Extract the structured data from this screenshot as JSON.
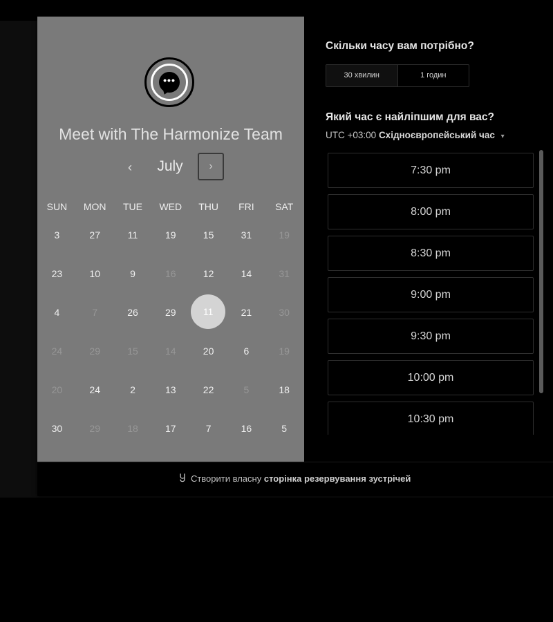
{
  "left": {
    "title": "Meet with The Harmonize Team",
    "logo_glyph": "•••",
    "month": "July",
    "prev_icon": "‹",
    "next_icon": "›"
  },
  "calendar": {
    "weekdays": [
      "SUN",
      "MON",
      "TUE",
      "WED",
      "THU",
      "FRI",
      "SAT"
    ],
    "weeks": [
      [
        {
          "d": "3",
          "off": false
        },
        {
          "d": "27",
          "off": false
        },
        {
          "d": "11",
          "off": false
        },
        {
          "d": "19",
          "off": false
        },
        {
          "d": "15",
          "off": false
        },
        {
          "d": "31",
          "off": false
        },
        {
          "d": "19",
          "off": true
        }
      ],
      [
        {
          "d": "23",
          "off": false
        },
        {
          "d": "10",
          "off": false
        },
        {
          "d": "9",
          "off": false
        },
        {
          "d": "16",
          "off": true
        },
        {
          "d": "12",
          "off": false
        },
        {
          "d": "14",
          "off": false
        },
        {
          "d": "31",
          "off": true
        }
      ],
      [
        {
          "d": "4",
          "off": false
        },
        {
          "d": "7",
          "off": true
        },
        {
          "d": "26",
          "off": false
        },
        {
          "d": "29",
          "off": false
        },
        {
          "d": "11",
          "off": false,
          "selected": true
        },
        {
          "d": "21",
          "off": false
        },
        {
          "d": "30",
          "off": true
        }
      ],
      [
        {
          "d": "24",
          "off": true
        },
        {
          "d": "29",
          "off": true
        },
        {
          "d": "15",
          "off": true
        },
        {
          "d": "14",
          "off": true
        },
        {
          "d": "20",
          "off": false
        },
        {
          "d": "6",
          "off": false
        },
        {
          "d": "19",
          "off": true
        }
      ],
      [
        {
          "d": "20",
          "off": true
        },
        {
          "d": "24",
          "off": false
        },
        {
          "d": "2",
          "off": false
        },
        {
          "d": "13",
          "off": false
        },
        {
          "d": "22",
          "off": false
        },
        {
          "d": "5",
          "off": true
        },
        {
          "d": "18",
          "off": false
        }
      ],
      [
        {
          "d": "30",
          "off": false
        },
        {
          "d": "29",
          "off": true
        },
        {
          "d": "18",
          "off": true
        },
        {
          "d": "17",
          "off": false
        },
        {
          "d": "7",
          "off": false
        },
        {
          "d": "16",
          "off": false
        },
        {
          "d": "5",
          "off": false
        }
      ]
    ]
  },
  "right": {
    "duration_heading": "Скільки часу вам потрібно?",
    "durations": [
      "30 хвилин",
      "1 годин"
    ],
    "time_heading": "Який час є найліпшим для вас?",
    "timezone_offset": "UTC +03:00",
    "timezone_name": "Східноєвропейський час",
    "timezone_caret": "▾",
    "slots": [
      "7:30 pm",
      "8:00 pm",
      "8:30 pm",
      "9:00 pm",
      "9:30 pm",
      "10:00 pm",
      "10:30 pm"
    ]
  },
  "footer": {
    "icon": "hubspot-sprocket-icon",
    "icon_glyph": "Ⴘ",
    "prefix": "Створити власну",
    "strong": "сторінка резервування зустрічей"
  }
}
